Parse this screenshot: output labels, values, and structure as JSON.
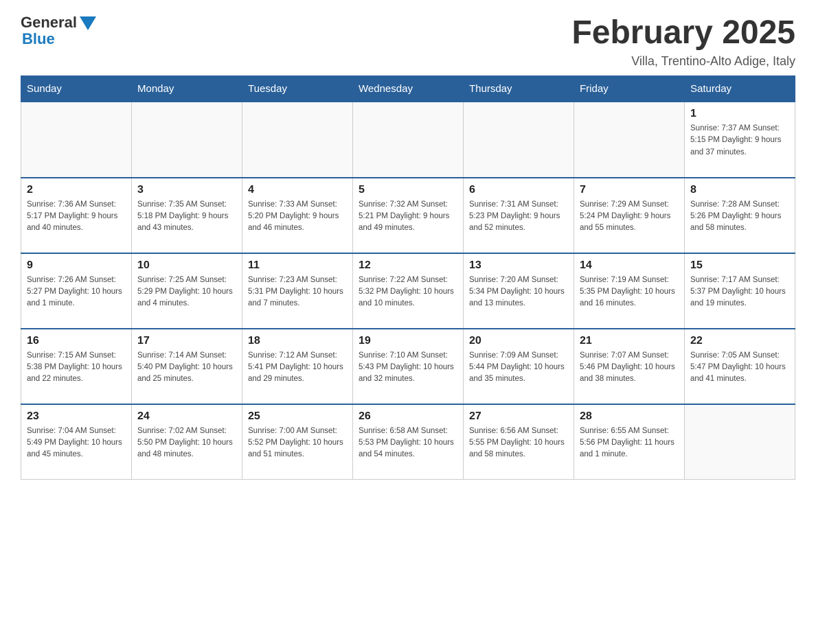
{
  "header": {
    "logo_general": "General",
    "logo_blue": "Blue",
    "month_title": "February 2025",
    "location": "Villa, Trentino-Alto Adige, Italy"
  },
  "weekdays": [
    "Sunday",
    "Monday",
    "Tuesday",
    "Wednesday",
    "Thursday",
    "Friday",
    "Saturday"
  ],
  "weeks": [
    [
      {
        "day": "",
        "info": ""
      },
      {
        "day": "",
        "info": ""
      },
      {
        "day": "",
        "info": ""
      },
      {
        "day": "",
        "info": ""
      },
      {
        "day": "",
        "info": ""
      },
      {
        "day": "",
        "info": ""
      },
      {
        "day": "1",
        "info": "Sunrise: 7:37 AM\nSunset: 5:15 PM\nDaylight: 9 hours and 37 minutes."
      }
    ],
    [
      {
        "day": "2",
        "info": "Sunrise: 7:36 AM\nSunset: 5:17 PM\nDaylight: 9 hours and 40 minutes."
      },
      {
        "day": "3",
        "info": "Sunrise: 7:35 AM\nSunset: 5:18 PM\nDaylight: 9 hours and 43 minutes."
      },
      {
        "day": "4",
        "info": "Sunrise: 7:33 AM\nSunset: 5:20 PM\nDaylight: 9 hours and 46 minutes."
      },
      {
        "day": "5",
        "info": "Sunrise: 7:32 AM\nSunset: 5:21 PM\nDaylight: 9 hours and 49 minutes."
      },
      {
        "day": "6",
        "info": "Sunrise: 7:31 AM\nSunset: 5:23 PM\nDaylight: 9 hours and 52 minutes."
      },
      {
        "day": "7",
        "info": "Sunrise: 7:29 AM\nSunset: 5:24 PM\nDaylight: 9 hours and 55 minutes."
      },
      {
        "day": "8",
        "info": "Sunrise: 7:28 AM\nSunset: 5:26 PM\nDaylight: 9 hours and 58 minutes."
      }
    ],
    [
      {
        "day": "9",
        "info": "Sunrise: 7:26 AM\nSunset: 5:27 PM\nDaylight: 10 hours and 1 minute."
      },
      {
        "day": "10",
        "info": "Sunrise: 7:25 AM\nSunset: 5:29 PM\nDaylight: 10 hours and 4 minutes."
      },
      {
        "day": "11",
        "info": "Sunrise: 7:23 AM\nSunset: 5:31 PM\nDaylight: 10 hours and 7 minutes."
      },
      {
        "day": "12",
        "info": "Sunrise: 7:22 AM\nSunset: 5:32 PM\nDaylight: 10 hours and 10 minutes."
      },
      {
        "day": "13",
        "info": "Sunrise: 7:20 AM\nSunset: 5:34 PM\nDaylight: 10 hours and 13 minutes."
      },
      {
        "day": "14",
        "info": "Sunrise: 7:19 AM\nSunset: 5:35 PM\nDaylight: 10 hours and 16 minutes."
      },
      {
        "day": "15",
        "info": "Sunrise: 7:17 AM\nSunset: 5:37 PM\nDaylight: 10 hours and 19 minutes."
      }
    ],
    [
      {
        "day": "16",
        "info": "Sunrise: 7:15 AM\nSunset: 5:38 PM\nDaylight: 10 hours and 22 minutes."
      },
      {
        "day": "17",
        "info": "Sunrise: 7:14 AM\nSunset: 5:40 PM\nDaylight: 10 hours and 25 minutes."
      },
      {
        "day": "18",
        "info": "Sunrise: 7:12 AM\nSunset: 5:41 PM\nDaylight: 10 hours and 29 minutes."
      },
      {
        "day": "19",
        "info": "Sunrise: 7:10 AM\nSunset: 5:43 PM\nDaylight: 10 hours and 32 minutes."
      },
      {
        "day": "20",
        "info": "Sunrise: 7:09 AM\nSunset: 5:44 PM\nDaylight: 10 hours and 35 minutes."
      },
      {
        "day": "21",
        "info": "Sunrise: 7:07 AM\nSunset: 5:46 PM\nDaylight: 10 hours and 38 minutes."
      },
      {
        "day": "22",
        "info": "Sunrise: 7:05 AM\nSunset: 5:47 PM\nDaylight: 10 hours and 41 minutes."
      }
    ],
    [
      {
        "day": "23",
        "info": "Sunrise: 7:04 AM\nSunset: 5:49 PM\nDaylight: 10 hours and 45 minutes."
      },
      {
        "day": "24",
        "info": "Sunrise: 7:02 AM\nSunset: 5:50 PM\nDaylight: 10 hours and 48 minutes."
      },
      {
        "day": "25",
        "info": "Sunrise: 7:00 AM\nSunset: 5:52 PM\nDaylight: 10 hours and 51 minutes."
      },
      {
        "day": "26",
        "info": "Sunrise: 6:58 AM\nSunset: 5:53 PM\nDaylight: 10 hours and 54 minutes."
      },
      {
        "day": "27",
        "info": "Sunrise: 6:56 AM\nSunset: 5:55 PM\nDaylight: 10 hours and 58 minutes."
      },
      {
        "day": "28",
        "info": "Sunrise: 6:55 AM\nSunset: 5:56 PM\nDaylight: 11 hours and 1 minute."
      },
      {
        "day": "",
        "info": ""
      }
    ]
  ]
}
